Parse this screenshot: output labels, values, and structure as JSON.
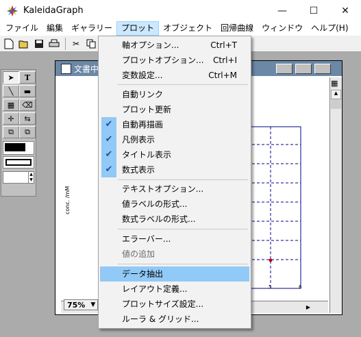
{
  "app": {
    "title": "KaleidaGraph"
  },
  "window_controls": {
    "minimize": "—",
    "maximize": "☐",
    "close": "✕"
  },
  "menubar": [
    {
      "label": "ファイル"
    },
    {
      "label": "編集"
    },
    {
      "label": "ギャラリー"
    },
    {
      "label": "プロット",
      "open": true
    },
    {
      "label": "オブジェクト"
    },
    {
      "label": "回帰曲線"
    },
    {
      "label": "ウィンドウ"
    },
    {
      "label": "ヘルプ(H)"
    }
  ],
  "toolbar": [
    "new-doc-icon",
    "open-folder-icon",
    "save-icon",
    "print-icon",
    "cut-icon",
    "copy-icon"
  ],
  "document": {
    "title": "文書中",
    "zoom": "75%",
    "ylabel": "conc. /mM",
    "x_ticks": [
      "5",
      "6"
    ]
  },
  "dropdown": {
    "groups": [
      [
        {
          "label": "軸オプション...",
          "shortcut": "Ctrl+T"
        },
        {
          "label": "プロットオプション...",
          "shortcut": "Ctrl+I"
        },
        {
          "label": "変数設定...",
          "shortcut": "Ctrl+M"
        }
      ],
      [
        {
          "label": "自動リンク"
        },
        {
          "label": "プロット更新"
        },
        {
          "label": "自動再描画",
          "checked": true
        },
        {
          "label": "凡例表示",
          "checked": true
        },
        {
          "label": "タイトル表示",
          "checked": true
        },
        {
          "label": "数式表示",
          "checked": true
        }
      ],
      [
        {
          "label": "テキストオプション..."
        },
        {
          "label": "値ラベルの形式..."
        },
        {
          "label": "数式ラベルの形式..."
        }
      ],
      [
        {
          "label": "エラーバー..."
        },
        {
          "label": "値の追加",
          "disabled": true
        }
      ],
      [
        {
          "label": "データ抽出",
          "highlighted": true
        },
        {
          "label": "レイアウト定義..."
        },
        {
          "label": "プロットサイズ設定..."
        },
        {
          "label": "ルーラ & グリッド..."
        }
      ]
    ]
  }
}
